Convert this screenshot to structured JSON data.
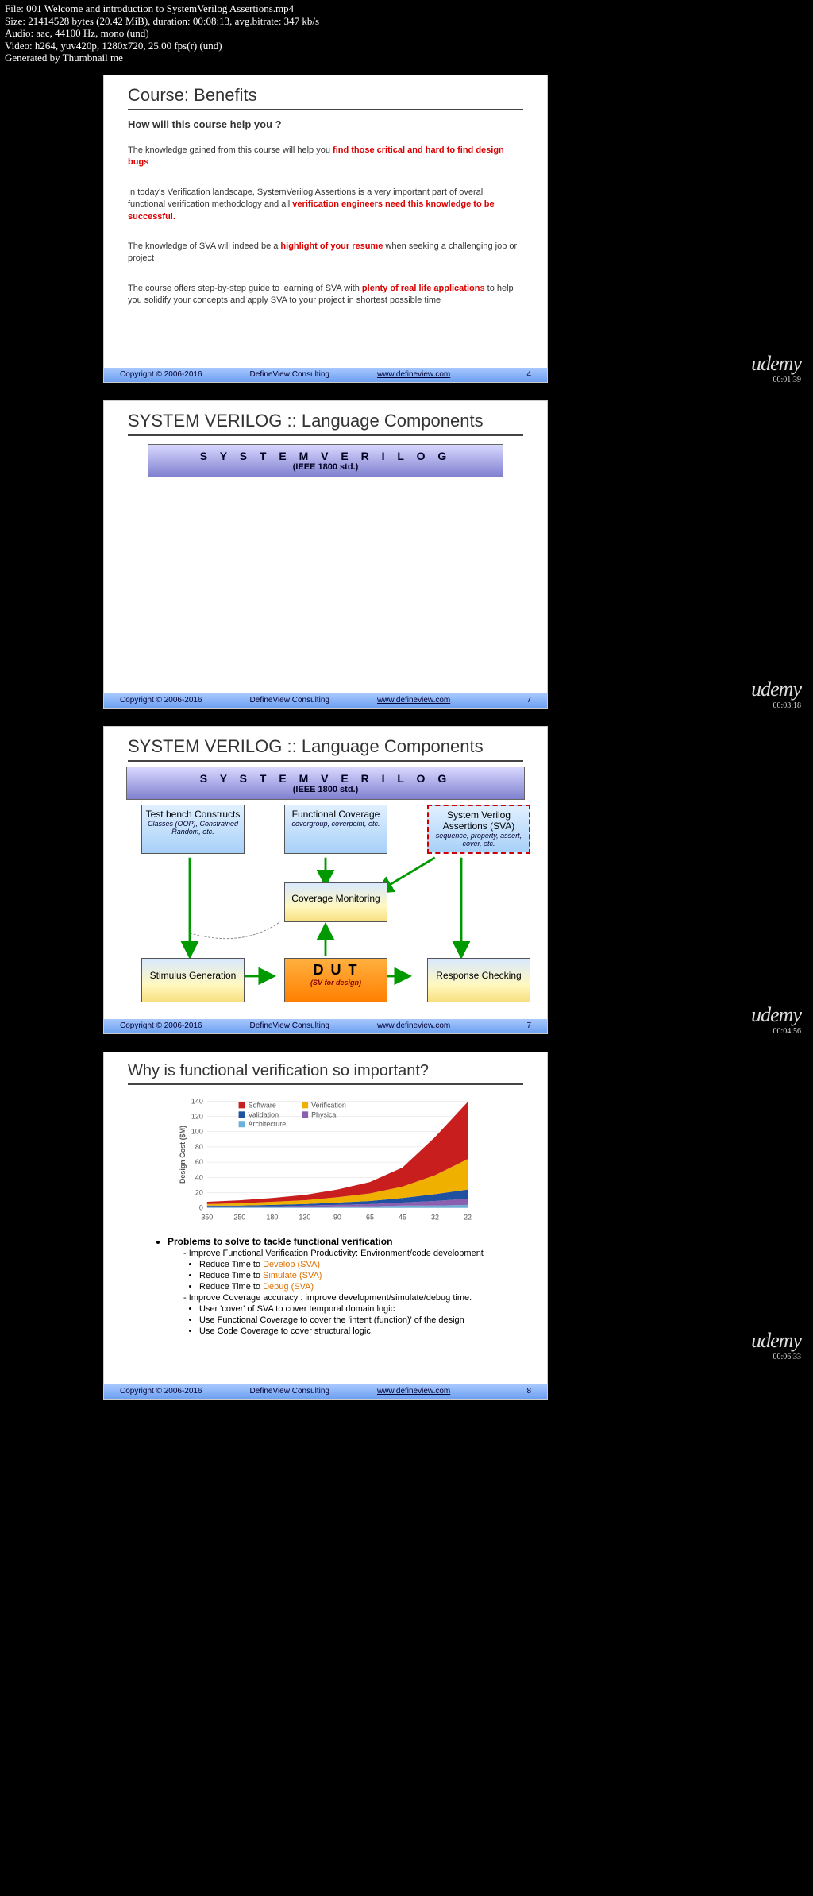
{
  "fileinfo": {
    "l1": "File: 001 Welcome and introduction to SystemVerilog Assertions.mp4",
    "l2": "Size: 21414528 bytes (20.42 MiB), duration: 00:08:13, avg.bitrate: 347 kb/s",
    "l3": "Audio: aac, 44100 Hz, mono (und)",
    "l4": "Video: h264, yuv420p, 1280x720, 25.00 fps(r) (und)",
    "l5": "Generated by Thumbnail me"
  },
  "watermark": {
    "logo": "udemy"
  },
  "times": {
    "t1": "00:01:39",
    "t2": "00:03:18",
    "t3": "00:04:56",
    "t4": "00:06:33"
  },
  "slide1": {
    "title": "Course: Benefits",
    "subtitle": "How will this course help you ?",
    "p1a": "The knowledge gained from this course will help you ",
    "p1b": "find those critical and hard to find design bugs",
    "p2a": "In today's Verification landscape, SystemVerilog Assertions is a very important part of overall functional verification methodology and all ",
    "p2b": "verification engineers need this knowledge to be successful.",
    "p3a": "The knowledge of SVA will indeed be a ",
    "p3b": "highlight of your resume",
    "p3c": " when seeking a challenging job or project",
    "p4a": "The course offers step-by-step guide to learning of SVA with ",
    "p4b": "plenty of real life applications",
    "p4c": " to help you solidify your concepts and apply SVA to your project in shortest possible time"
  },
  "footer": {
    "copy": "Copyright © 2006-2016",
    "company": "DefineView Consulting",
    "url": "www.defineview.com",
    "pg4": "4",
    "pg7": "7",
    "pg8": "8"
  },
  "slide23": {
    "title": "SYSTEM VERILOG :: Language Components",
    "header_t1": "S Y S T E M    V E R I L O G",
    "header_t2": "(IEEE 1800 std.)",
    "box_tb_t": "Test bench Constructs",
    "box_tb_s": "Classes (OOP), Constrained Random, etc.",
    "box_fc_t": "Functional Coverage",
    "box_fc_s": "covergroup, coverpoint, etc.",
    "box_sva_t": "System Verilog Assertions (SVA)",
    "box_sva_s": "sequence, property, assert, cover, etc.",
    "box_cm": "Coverage Monitoring",
    "box_sg": "Stimulus Generation",
    "box_dut_t": "D U T",
    "box_dut_s": "(SV for design)",
    "box_rc": "Response Checking"
  },
  "slide4": {
    "title": "Why is functional verification so important?",
    "legend": {
      "sw": "Software",
      "ver": "Verification",
      "val": "Validation",
      "phy": "Physical",
      "arch": "Architecture"
    },
    "ylabel": "Design Cost ($M)",
    "bhead": "Problems to solve to tackle functional verification",
    "b1": "Improve Functional Verification Productivity: Environment/code development",
    "b1a_pre": "Reduce Time to ",
    "b1a_hl": "Develop (SVA)",
    "b1b_pre": "Reduce Time to ",
    "b1b_hl": "Simulate (SVA)",
    "b1c_pre": "Reduce Time to ",
    "b1c_hl": "Debug (SVA)",
    "b2": "Improve Coverage accuracy : improve development/simulate/debug time.",
    "b2a": "User 'cover' of SVA to cover temporal domain logic",
    "b2b": "Use Functional Coverage to cover the 'intent (function)' of the design",
    "b2c": "Use Code Coverage to cover structural logic."
  },
  "chart_data": {
    "type": "area",
    "title": "",
    "xlabel": "",
    "ylabel": "Design Cost ($M)",
    "ylim": [
      0,
      140
    ],
    "categories": [
      "350",
      "250",
      "180",
      "130",
      "90",
      "65",
      "45",
      "32",
      "22"
    ],
    "series": [
      {
        "name": "Architecture",
        "color": "#6bb0d8",
        "values": [
          1,
          1,
          1,
          1,
          2,
          2,
          3,
          3,
          4
        ]
      },
      {
        "name": "Physical",
        "color": "#8a5fb0",
        "values": [
          1,
          1,
          1,
          2,
          2,
          3,
          4,
          6,
          8
        ]
      },
      {
        "name": "Validation",
        "color": "#2050a0",
        "values": [
          1,
          1,
          2,
          2,
          3,
          4,
          6,
          9,
          12
        ]
      },
      {
        "name": "Verification",
        "color": "#f0b000",
        "values": [
          2,
          3,
          4,
          5,
          7,
          10,
          15,
          25,
          40
        ]
      },
      {
        "name": "Software",
        "color": "#c81e1e",
        "values": [
          3,
          4,
          5,
          7,
          10,
          15,
          25,
          50,
          75
        ]
      }
    ]
  }
}
